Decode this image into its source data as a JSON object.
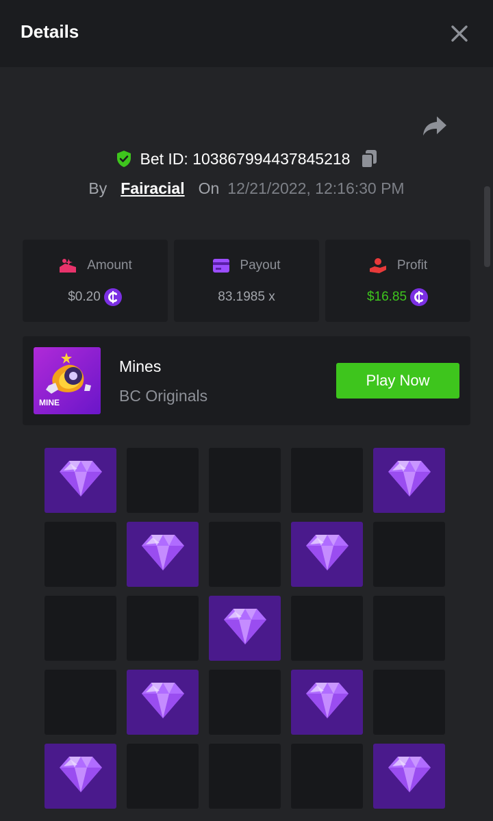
{
  "header": {
    "title": "Details"
  },
  "bet": {
    "id_text": "Bet ID: 103867994437845218",
    "by_label": "By",
    "username": "Fairacial",
    "on_label": "On",
    "date": "12/21/2022, 12:16:30 PM"
  },
  "stats": {
    "amount": {
      "label": "Amount",
      "value": "$0.20"
    },
    "payout": {
      "label": "Payout",
      "value": "83.1985 x"
    },
    "profit": {
      "label": "Profit",
      "value": "$16.85"
    }
  },
  "game": {
    "thumb_label": "MINE",
    "name": "Mines",
    "provider": "BC Originals",
    "play_label": "Play Now"
  },
  "grid": {
    "rows": 5,
    "cols": 5,
    "cells": [
      "gem",
      "empty",
      "empty",
      "empty",
      "gem",
      "empty",
      "gem",
      "empty",
      "gem",
      "empty",
      "empty",
      "empty",
      "gem",
      "empty",
      "empty",
      "empty",
      "gem",
      "empty",
      "gem",
      "empty",
      "gem",
      "empty",
      "empty",
      "empty",
      "gem"
    ]
  },
  "colors": {
    "accent_green": "#3ec51d",
    "gem_tile": "#4a1a8c",
    "empty_tile": "#17181b",
    "coin_purple": "#7b2fe3"
  },
  "icons": {
    "close": "close-icon",
    "share": "share-icon",
    "verified": "shield-check-icon",
    "copy": "copy-icon",
    "amount": "amount-icon",
    "payout": "card-icon",
    "profit": "profit-icon",
    "coin": "bc-coin-icon",
    "gem": "gem-icon"
  }
}
